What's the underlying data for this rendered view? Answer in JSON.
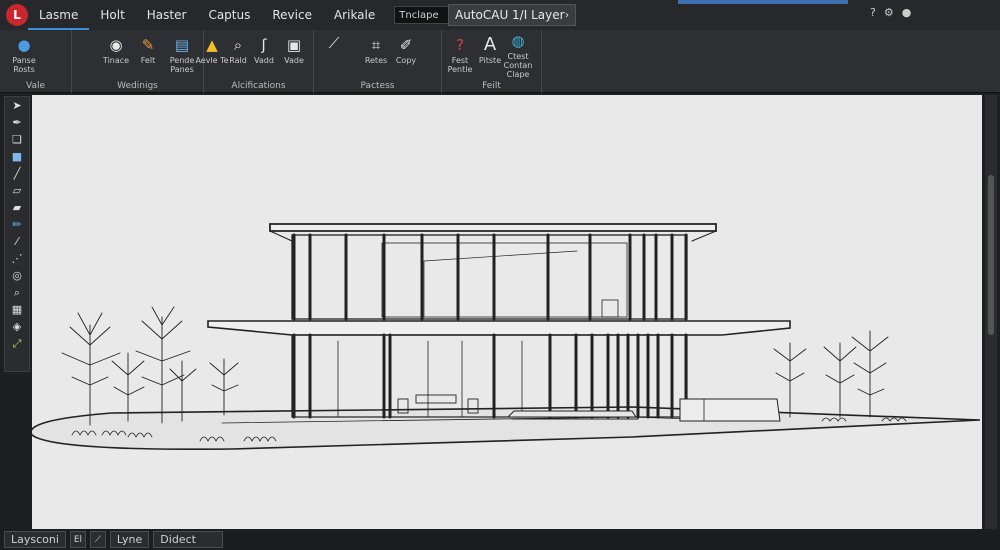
{
  "menu": {
    "logo": "L",
    "items": [
      "Lasme",
      "Holt",
      "Haster",
      "Captus",
      "Revice",
      "Arikale"
    ],
    "search_value": "Tnclape",
    "layer_dropdown": "AutoCAU 1/I Layer"
  },
  "ribbon": {
    "panels": [
      {
        "title": "Vale",
        "tools": [
          {
            "icon": "user-icon",
            "label": "Panse Rosts"
          }
        ]
      },
      {
        "title": "Wedinigs",
        "tools": [
          {
            "icon": "eye-icon",
            "label": "Tinace"
          },
          {
            "icon": "brush-icon",
            "label": "Felt"
          },
          {
            "icon": "document-icon",
            "label": "Pende Panes"
          }
        ]
      },
      {
        "title": "Alcifications",
        "tools": [
          {
            "icon": "warning-icon",
            "label": "Aevle Te"
          },
          {
            "icon": "magnifier-icon",
            "label": "Rald"
          },
          {
            "icon": "script-icon",
            "label": "Vadd"
          },
          {
            "icon": "clipboard-icon",
            "label": "Vade"
          }
        ]
      },
      {
        "title": "Pactess",
        "tools": [
          {
            "icon": "pen-tools-icon",
            "label": ""
          },
          {
            "icon": "crop-icon",
            "label": "Retes"
          },
          {
            "icon": "pencil-icon",
            "label": "Copy"
          }
        ]
      },
      {
        "title": "Feilt",
        "tools": [
          {
            "icon": "question-icon",
            "label": "Fest Pentle"
          },
          {
            "icon": "text-a-icon",
            "label": "Pitste"
          },
          {
            "icon": "globe-icon",
            "label": "Ctest Contan Clape"
          }
        ]
      }
    ]
  },
  "status": {
    "tabs": [
      "Laysconi",
      "El",
      "Lyne",
      "Didect"
    ]
  },
  "colors": {
    "background": "#1e1f21",
    "canvas": "#e9e9e9",
    "accent": "#3d8fd6",
    "logo": "#c8282d"
  }
}
